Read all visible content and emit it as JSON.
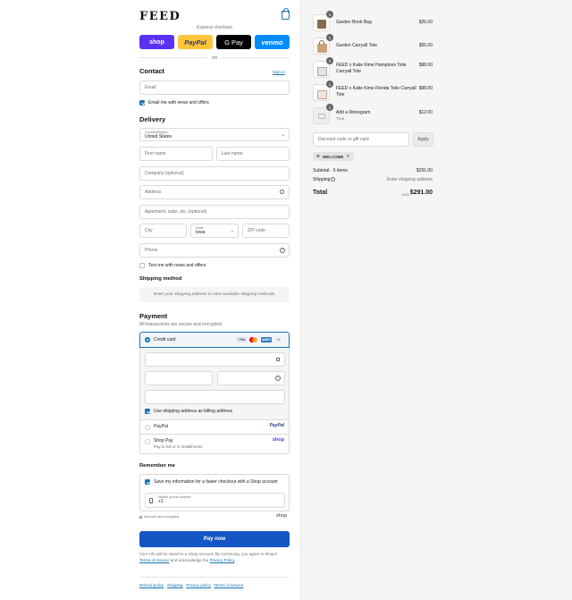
{
  "header": {
    "logo": "FEED"
  },
  "express": {
    "label": "Express checkout",
    "buttons": [
      {
        "label": "shop",
        "color": "#5a31f4"
      },
      {
        "label": "PayPal",
        "color": "#ffc439"
      },
      {
        "label": "G Pay",
        "color": "#000000"
      },
      {
        "label": "venmo",
        "color": "#008cff"
      }
    ],
    "or": "OR"
  },
  "contact": {
    "title": "Contact",
    "sign_in": "Sign in",
    "email_placeholder": "Email",
    "news_label": "Email me with news and offers"
  },
  "delivery": {
    "title": "Delivery",
    "country_label": "Country/Region",
    "country_value": "United States",
    "first_name": "First name",
    "last_name": "Last name",
    "company": "Company (optional)",
    "address": "Address",
    "apartment": "Apartment, suite, etc. (optional)",
    "city": "City",
    "state_label": "State",
    "state_value": "Iowa",
    "zip": "ZIP code",
    "phone": "Phone",
    "text_label": "Text me with news and offers"
  },
  "shipping": {
    "title": "Shipping method",
    "note": "Enter your shipping address to view available shipping methods."
  },
  "payment": {
    "title": "Payment",
    "subtitle": "All transactions are secure and encrypted.",
    "credit_card": "Credit card",
    "card_brands": [
      "VISA",
      "MC",
      "AMEX",
      "+4"
    ],
    "billing_label": "Use shipping address as billing address",
    "paypal": "PayPal",
    "paypal_logo": "PayPal",
    "shop_pay": "Shop Pay",
    "shop_pay_sub": "Pay in full or in installments",
    "shop_logo": "shop"
  },
  "remember": {
    "title": "Remember me",
    "save_label": "Save my information for a faster checkout with a Shop account",
    "mobile_label": "Mobile phone number",
    "mobile_value": "+1",
    "secure": "Secured and encrypted",
    "shop_logo": "shop"
  },
  "pay_button": "Pay now",
  "legal": {
    "line1": "Your info will be saved to a Shop account. By continuing, you agree to Shop’s",
    "terms": "Terms of Service",
    "mid": "and acknowledge the",
    "privacy": "Privacy Policy",
    "end": "."
  },
  "footer": [
    "Refund policy",
    "Shipping",
    "Privacy policy",
    "Terms of service"
  ],
  "cart": {
    "items": [
      {
        "qty": "1",
        "name": "Garden Book Bag",
        "price": "$26.00",
        "sub": ""
      },
      {
        "qty": "1",
        "name": "Garden Carryall Tote",
        "price": "$55.00",
        "sub": ""
      },
      {
        "qty": "1",
        "name": "FEED x Katie Kime Hamptons Toile Carryall Tote",
        "price": "$98.00",
        "sub": ""
      },
      {
        "qty": "1",
        "name": "FEED x Katie Kime Florida Toile Carryall Tote",
        "price": "$98.00",
        "sub": ""
      },
      {
        "qty": "1",
        "name": "Add a Monogram",
        "price": "$12.00",
        "sub": "True"
      }
    ],
    "discount_placeholder": "Discount code or gift card",
    "apply": "Apply",
    "tag": "WELCOME",
    "subtotal_label": "Subtotal · 5 items",
    "subtotal_value": "$291.00",
    "shipping_label": "Shipping",
    "shipping_value": "Enter shipping address",
    "total_label": "Total",
    "currency": "USD",
    "total_value": "$291.00"
  }
}
